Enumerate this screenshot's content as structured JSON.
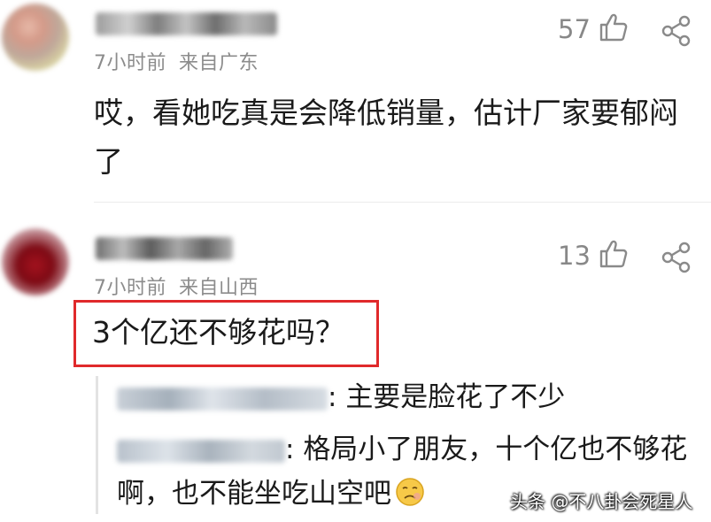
{
  "comments": [
    {
      "time": "7小时前",
      "location": "来自广东",
      "likes": "57",
      "text": "哎，看她吃真是会降低销量，估计厂家要郁闷了"
    },
    {
      "time": "7小时前",
      "location": "来自山西",
      "likes": "13",
      "text": "3个亿还不够花吗？",
      "replies": [
        {
          "separator": ": ",
          "text": "主要是脸花了不少"
        },
        {
          "separator": ": ",
          "text": "格局小了朋友，十个亿也不够花啊，也不能坐吃山空吧"
        }
      ]
    }
  ],
  "colors": {
    "highlight_border": "#e0292b",
    "meta_gray": "#8c8c8c",
    "text": "#1a1a1a"
  },
  "icons": {
    "like": "thumbs-up-icon",
    "share": "share-icon",
    "emoji": "pleading-face-emoji"
  },
  "watermark": "头条 @不八卦会死星人"
}
